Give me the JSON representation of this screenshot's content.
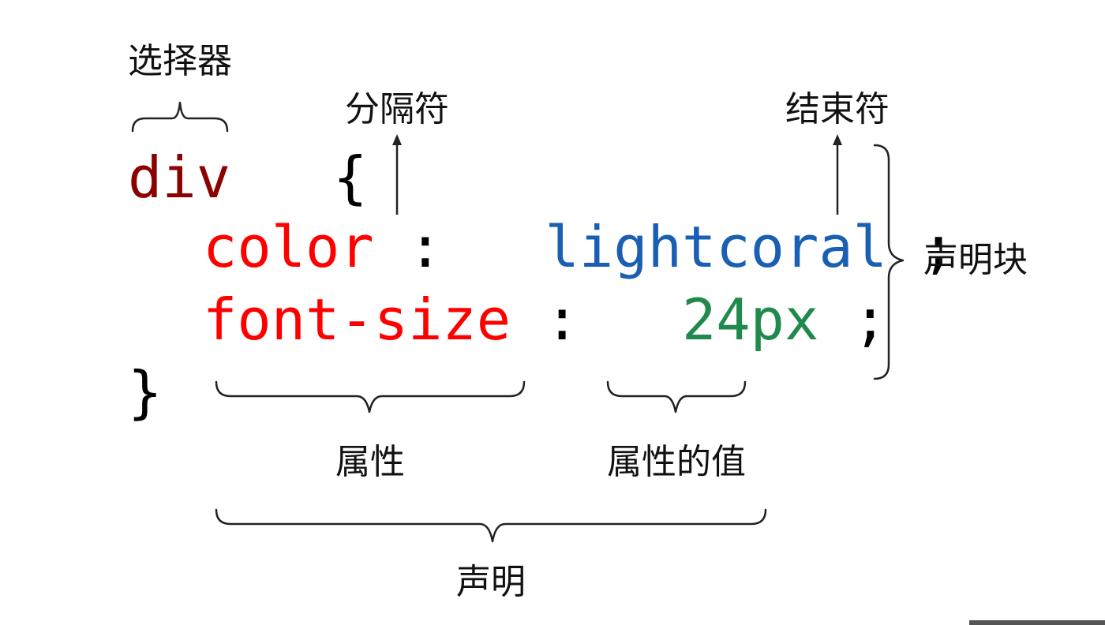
{
  "code": {
    "selector": "div",
    "open_brace": "{",
    "close_brace": "}",
    "declarations": [
      {
        "property": "color",
        "separator": ":",
        "value": "lightcoral",
        "terminator": ";"
      },
      {
        "property": "font-size",
        "separator": ":",
        "value": "24px",
        "terminator": ";"
      }
    ]
  },
  "labels": {
    "selector": "选择器",
    "separator": "分隔符",
    "terminator": "结束符",
    "declaration_block": "声明块",
    "property": "属性",
    "property_value": "属性的值",
    "declaration": "声明"
  },
  "colors": {
    "selector": "#8b0000",
    "property": "#ff0000",
    "keyword_value": "#1a5fb4",
    "number_value": "#1f8a4c",
    "punctuation": "#000000"
  }
}
